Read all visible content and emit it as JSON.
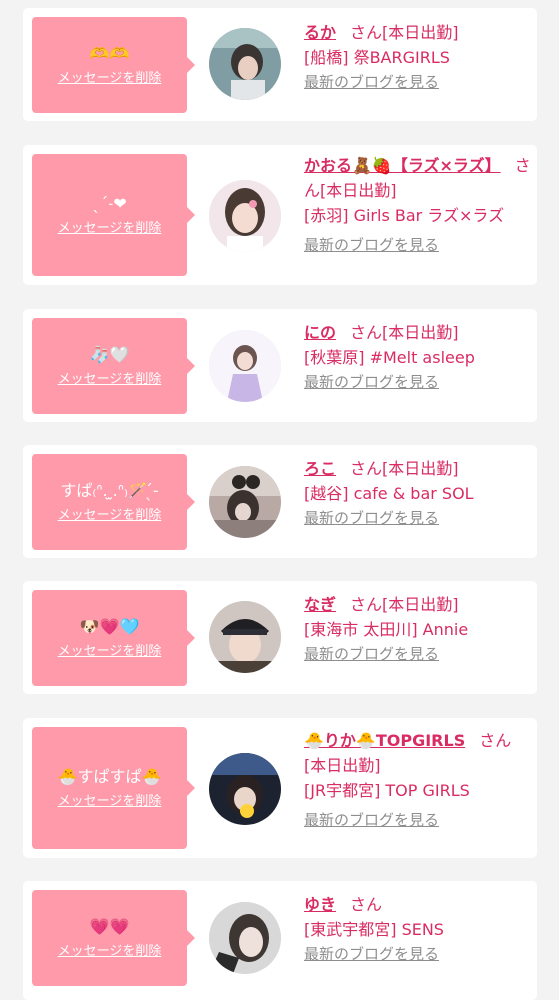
{
  "cards": [
    {
      "message": "🫶🫶",
      "delete_label": "メッセージを削除",
      "name": "るか",
      "suffix": "さん",
      "status": "[本日出勤]",
      "shop": "[船橋] 祭BARGIRLS",
      "blog_label": "最新のブログを見る"
    },
    {
      "message": "ˎˊ˗❤︎",
      "delete_label": "メッセージを削除",
      "name": "かおる🧸🍓【ラズ×ラズ】",
      "suffix": "さん",
      "status": "[本日出勤]",
      "shop": "[赤羽] Girls Bar ラズ×ラズ",
      "blog_label": "最新のブログを見る"
    },
    {
      "message": "🧦🤍",
      "delete_label": "メッセージを削除",
      "name": "にの",
      "suffix": "さん",
      "status": "[本日出勤]",
      "shop": "[秋葉原] #Melt asleep",
      "blog_label": "最新のブログを見る"
    },
    {
      "message": "すぱ₍ᐢ. ̫.ᐢ₎🪄 ̖́-",
      "delete_label": "メッセージを削除",
      "name": "ろこ",
      "suffix": "さん",
      "status": "[本日出勤]",
      "shop": "[越谷] cafe & bar SOL",
      "blog_label": "最新のブログを見る"
    },
    {
      "message": "🐶💗🩵",
      "delete_label": "メッセージを削除",
      "name": "なぎ",
      "suffix": "さん",
      "status": "[本日出勤]",
      "shop": "[東海市 太田川] Annie",
      "blog_label": "最新のブログを見る"
    },
    {
      "message": "🐣すぱすぱ🐣",
      "delete_label": "メッセージを削除",
      "name": "🐣りか🐣TOPGIRLS",
      "suffix": "さん",
      "status": "[本日出勤]",
      "shop": "[JR宇都宮] TOP GIRLS",
      "blog_label": "最新のブログを見る"
    },
    {
      "message": "💗💗",
      "delete_label": "メッセージを削除",
      "name": "ゆき",
      "suffix": "さん",
      "status": "",
      "shop": "[東武宇都宮] SENS",
      "blog_label": "最新のブログを見る"
    }
  ],
  "colors": {
    "accent": "#d92c63",
    "bubble": "#fe9aaa",
    "muted": "#8e8e8e",
    "background": "#f3f3f4"
  }
}
